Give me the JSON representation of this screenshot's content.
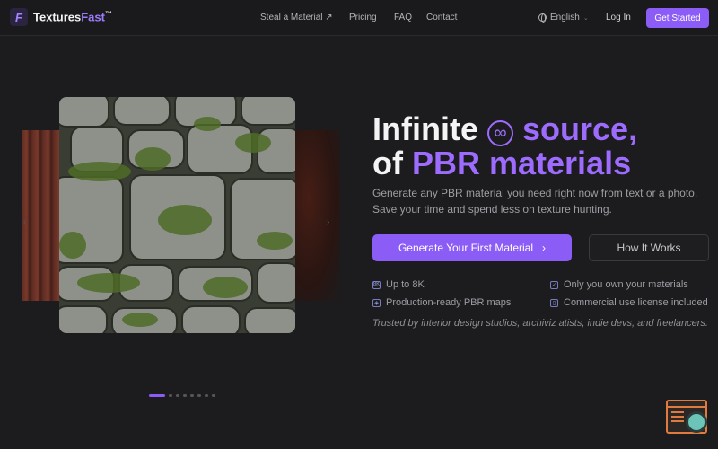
{
  "brand": {
    "logo_glyph": "F",
    "name_main": "Textures",
    "name_accent": "Fast",
    "trademark": "™",
    "accent_color": "#9d7bff"
  },
  "nav": {
    "steal": "Steal a Material ↗",
    "pricing": "Pricing",
    "faq": "FAQ",
    "contact": "Contact"
  },
  "header_right": {
    "language": "English",
    "login": "Log In",
    "get_started": "Get Started"
  },
  "hero": {
    "title_line1_a": "Infinite",
    "title_icon": "∞",
    "title_line1_b": "source,",
    "title_line2_a": "of",
    "title_line2_b": "PBR materials",
    "subtitle": "Generate any PBR material you need right now from text or a photo. Save your time and spend less on texture hunting.",
    "cta_primary": "Generate Your First Material",
    "cta_primary_icon": "›",
    "cta_secondary": "How It Works"
  },
  "features": [
    {
      "icon": "8K",
      "icon_name": "resolution-icon",
      "text": "Up to 8K"
    },
    {
      "icon": "✓",
      "icon_name": "check-icon",
      "text": "Only you own your materials"
    },
    {
      "icon": "◈",
      "icon_name": "layers-icon",
      "text": "Production-ready PBR maps"
    },
    {
      "icon": "▯",
      "icon_name": "document-icon",
      "text": "Commercial use license included"
    }
  ],
  "trusted": "Trusted by interior design studios, archiviz atists, indie devs, and freelancers.",
  "carousel": {
    "prev_icon": "‹",
    "next_icon": "›",
    "slide_count": 8,
    "active_index": 0
  },
  "colors": {
    "primary": "#8b5cf6",
    "background": "#1c1c1e",
    "widget": "#e07a3e"
  }
}
